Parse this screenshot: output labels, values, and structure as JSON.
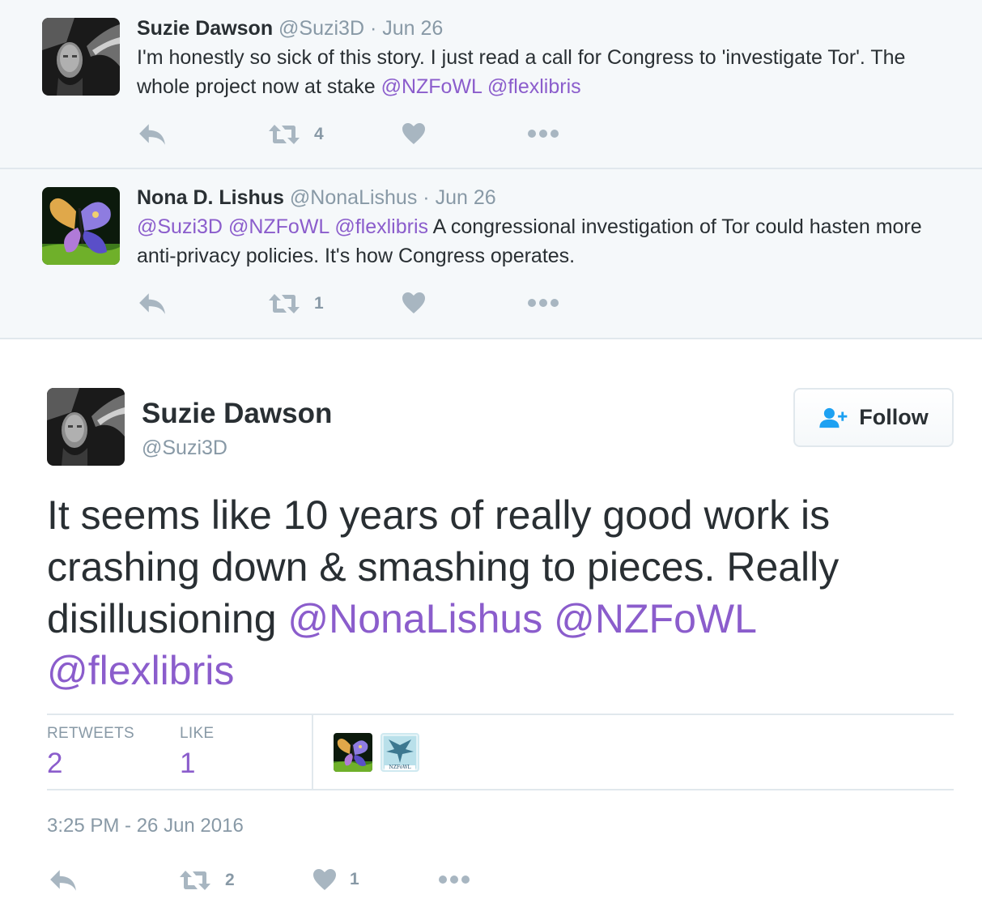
{
  "colors": {
    "mention": "#8b5dcc",
    "muted": "#8899a6",
    "text": "#292f33",
    "context_bg": "#f5f8fa",
    "border": "#e1e8ed"
  },
  "context_tweets": [
    {
      "name": "Suzie Dawson",
      "handle": "@Suzi3D",
      "date": "· Jun 26",
      "text_before": "I'm honestly so sick of this story. I just read a call for Congress to 'investigate Tor'. The whole project now at stake ",
      "mentions": [
        "@NZFoWL",
        "@flexlibris"
      ],
      "text_after": "",
      "retweet_count": "4",
      "like_count": "",
      "avatar_icon": "avatar-face-portrait"
    },
    {
      "name": "Nona D. Lishus",
      "handle": "@NonaLishus",
      "date": "· Jun 26",
      "mentions": [
        "@Suzi3D",
        "@NZFoWL",
        "@flexlibris"
      ],
      "text": " A congressional investigation of Tor could hasten more anti-privacy policies. It's how Congress operates.",
      "retweet_count": "1",
      "like_count": "",
      "avatar_icon": "avatar-butterfly"
    }
  ],
  "main_tweet": {
    "name": "Suzie Dawson",
    "handle": "@Suzi3D",
    "follow_label": "Follow",
    "text": "It seems like 10 years of really good work is crashing down & smashing to pieces. Really disillusioning ",
    "mentions": [
      "@NonaLishus",
      "@NZFoWL",
      "@flexlibris"
    ],
    "stats": {
      "retweets_label": "RETWEETS",
      "retweets_value": "2",
      "likes_label": "LIKE",
      "likes_value": "1"
    },
    "likers": [
      {
        "icon": "avatar-butterfly"
      },
      {
        "icon": "avatar-nzfowl-bird",
        "caption": "NZFoWL"
      }
    ],
    "timestamp": "3:25 PM - 26 Jun 2016",
    "retweet_count": "2",
    "like_count": "1"
  },
  "icons": {
    "reply": "reply-arrow-icon",
    "retweet": "retweet-icon",
    "like": "heart-icon",
    "more": "more-dots-icon",
    "follow": "add-user-icon"
  }
}
